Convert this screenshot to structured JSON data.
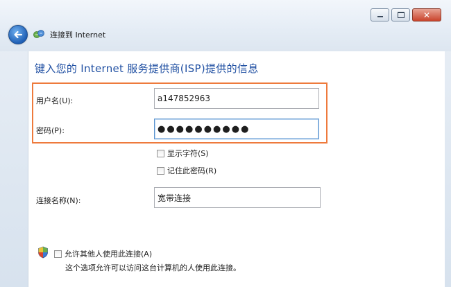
{
  "window": {
    "title": "连接到 Internet",
    "icons": [
      "back-arrow-icon",
      "network-icon",
      "minimize-icon",
      "maximize-icon",
      "close-icon",
      "shield-icon"
    ]
  },
  "page": {
    "heading": "键入您的 Internet 服务提供商(ISP)提供的信息"
  },
  "form": {
    "username_label": "用户名(U):",
    "username_value": "a147852963",
    "password_label": "密码(P):",
    "password_value": "●●●●●●●●●●",
    "show_chars_label": "显示字符(S)",
    "remember_label": "记住此密码(R)",
    "conn_name_label": "连接名称(N):",
    "conn_name_value": "宽带连接",
    "allow_label": "允许其他人使用此连接(A)",
    "allow_desc": "这个选项允许可以访问这台计算机的人使用此连接。"
  },
  "colors": {
    "highlight": "#ee7a3c",
    "heading": "#1f4fa2",
    "back_button": "#1f5fb5"
  }
}
